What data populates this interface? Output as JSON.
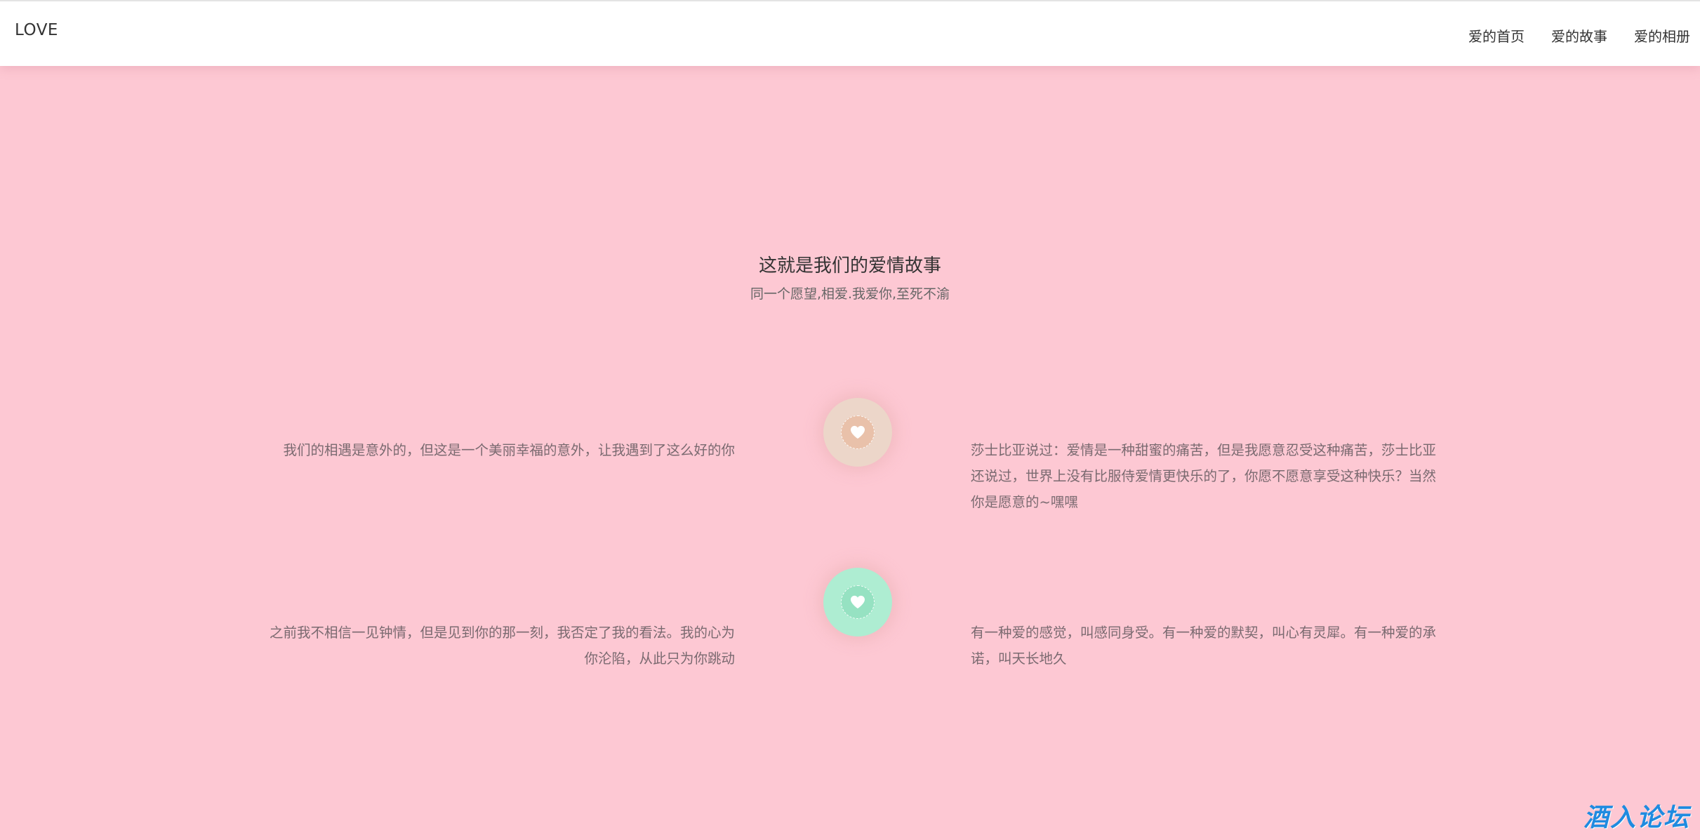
{
  "header": {
    "brand": "LOVE",
    "nav": [
      "爱的首页",
      "爱的故事",
      "爱的相册"
    ]
  },
  "section": {
    "title": "这就是我们的爱情故事",
    "subtitle": "同一个愿望,相爱.我爱你,至死不渝"
  },
  "stories": {
    "row1": {
      "left": "我们的相遇是意外的，但这是一个美丽幸福的意外，让我遇到了这么好的你",
      "right": "莎士比亚说过：爱情是一种甜蜜的痛苦，但是我愿意忍受这种痛苦，莎士比亚还说过，世界上没有比服侍爱情更快乐的了，你愿不愿意享受这种快乐？当然你是愿意的~嘿嘿"
    },
    "row2": {
      "left": "之前我不相信一见钟情，但是见到你的那一刻，我否定了我的看法。我的心为你沦陷，从此只为你跳动",
      "right": "有一种爱的感觉，叫感同身受。有一种爱的默契，叫心有灵犀。有一种爱的承诺，叫天长地久"
    }
  },
  "badges": {
    "icon": "heart-icon",
    "colors": [
      "#ecd6c9",
      "#aeedd2"
    ]
  },
  "watermark": "酒入论坛",
  "colors": {
    "background": "#fdc8d3",
    "header": "#ffffff",
    "watermark": "#1f8be0"
  }
}
